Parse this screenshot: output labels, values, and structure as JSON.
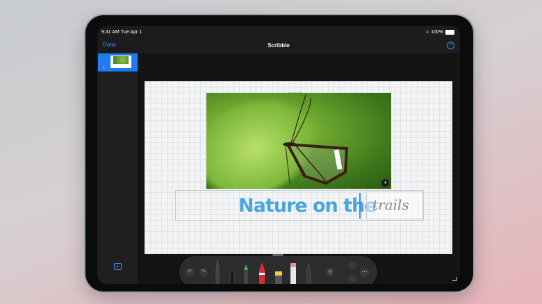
{
  "status": {
    "time": "9:41 AM",
    "date": "Tue Apr 1",
    "battery": "100%"
  },
  "nav": {
    "done_label": "Done",
    "title": "Scribble"
  },
  "sidebar": {
    "thumb_number": "1"
  },
  "canvas": {
    "typed_text": "Nature on the",
    "handwritten_text": "trails"
  },
  "icons": {
    "undo": "undo-icon",
    "redo": "redo-icon",
    "add": "plus-icon",
    "more": "ellipsis-icon",
    "wifi": "wifi-icon",
    "battery": "battery-icon"
  },
  "tools": [
    "pen",
    "monoline",
    "fountain-pen",
    "crayon",
    "highlighter",
    "eraser",
    "pencil"
  ],
  "colors": {
    "accent": "#3a8ff5",
    "typed_text": "#4aa5dc"
  }
}
